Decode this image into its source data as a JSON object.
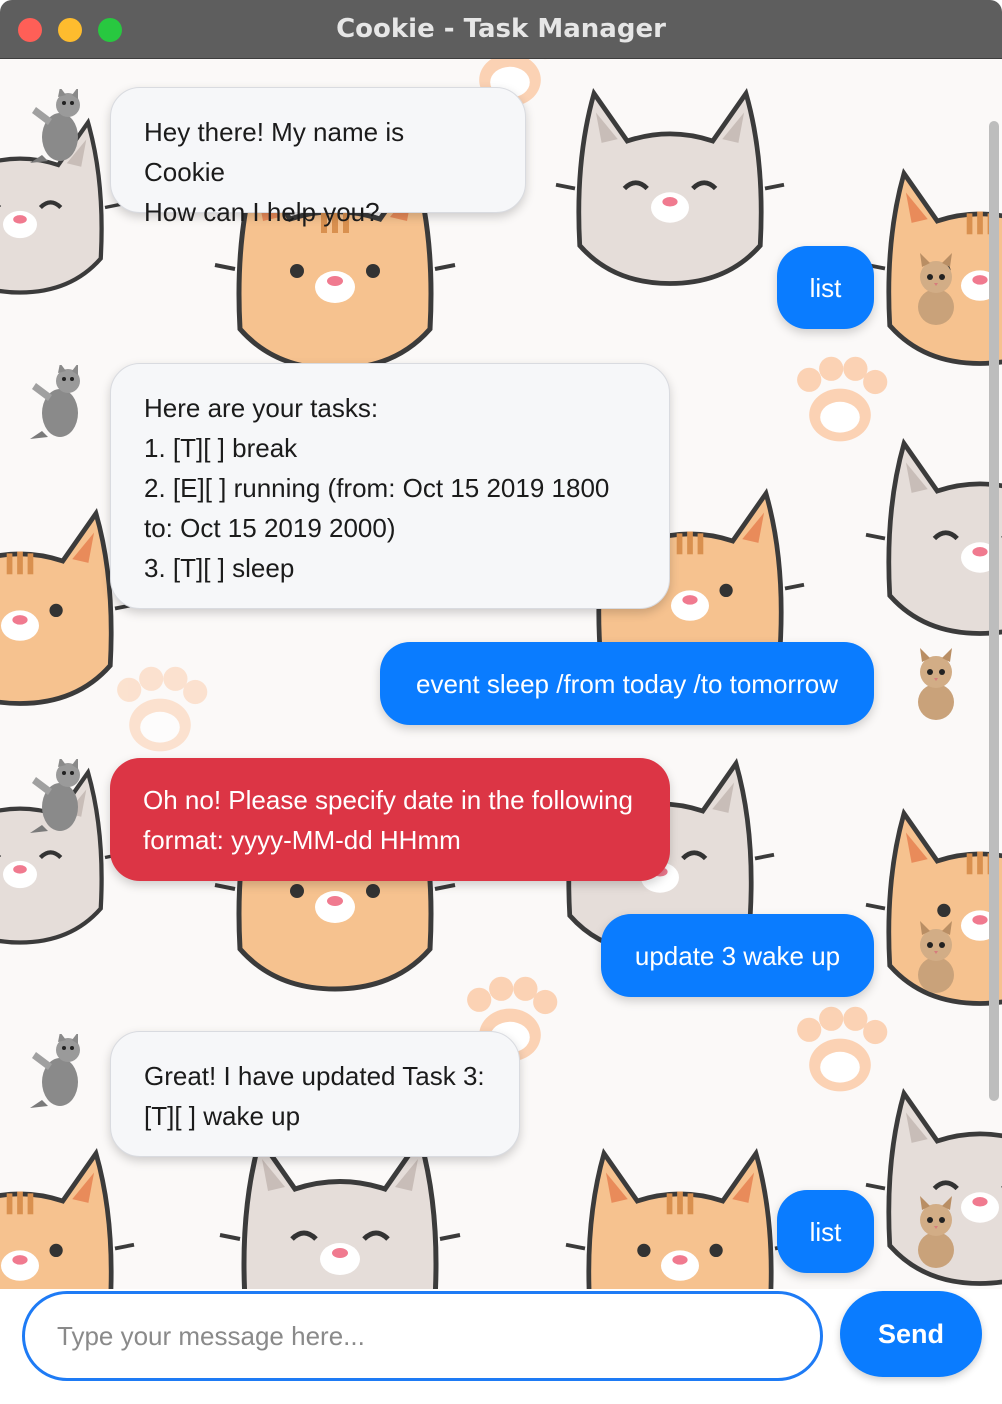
{
  "window": {
    "title": "Cookie - Task Manager"
  },
  "messages": [
    {
      "sender": "bot",
      "text": "Hey there! My name is Cookie\nHow can I help you?"
    },
    {
      "sender": "user",
      "text": "list"
    },
    {
      "sender": "bot",
      "text": "Here are your tasks:\n1. [T][ ] break\n2. [E][ ] running (from: Oct 15 2019 1800\nto: Oct 15 2019 2000)\n3. [T][ ] sleep"
    },
    {
      "sender": "user",
      "text": "event sleep /from today /to tomorrow"
    },
    {
      "sender": "bot-error",
      "text": "Oh no! Please specify date in the following\nformat: yyyy-MM-dd HHmm"
    },
    {
      "sender": "user",
      "text": "update 3 wake up"
    },
    {
      "sender": "bot",
      "text": "Great! I have updated Task 3:\n[T][ ] wake up"
    },
    {
      "sender": "user",
      "text": "list"
    }
  ],
  "input": {
    "placeholder": "Type your message here...",
    "value": ""
  },
  "send_button": {
    "label": "Send"
  },
  "colors": {
    "user_bubble": "#0a7cff",
    "error_bubble": "#dc3545",
    "bot_bubble": "#f6f7f9",
    "titlebar": "#5e5e5e"
  },
  "icons": {
    "bot_avatar": "waving-kitten-avatar",
    "user_avatar": "kitten-avatar"
  }
}
